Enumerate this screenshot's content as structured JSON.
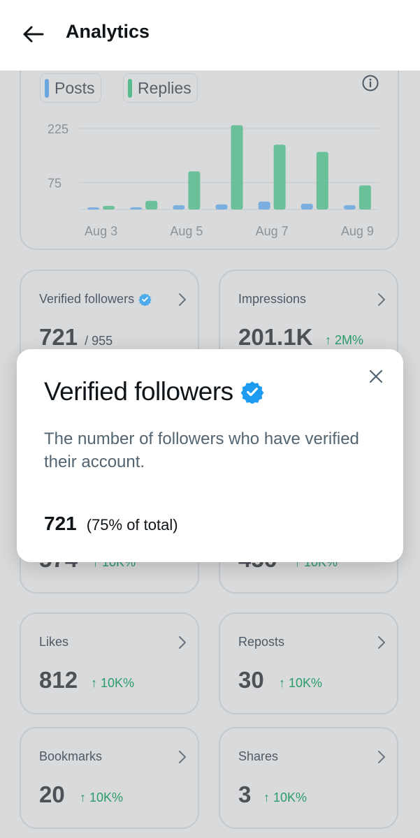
{
  "header": {
    "title": "Analytics"
  },
  "colors": {
    "posts": "#6aa7e0",
    "replies": "#56bb8d",
    "verified_badge": "#1d9bf0",
    "change_positive": "#2a9c69"
  },
  "legend": {
    "posts": "Posts",
    "replies": "Replies"
  },
  "chart_data": {
    "type": "bar",
    "categories": [
      "Aug 3",
      "Aug 4",
      "Aug 5",
      "Aug 6",
      "Aug 7",
      "Aug 8",
      "Aug 9"
    ],
    "x_tick_labels": [
      "Aug 3",
      "Aug 5",
      "Aug 7",
      "Aug 9"
    ],
    "y_tick_labels": [
      "225",
      "75"
    ],
    "ylim": [
      0,
      240
    ],
    "grid": true,
    "legend_position": "top-left",
    "series": [
      {
        "name": "Posts",
        "values": [
          3,
          6,
          12,
          14,
          22,
          16,
          12
        ]
      },
      {
        "name": "Replies",
        "values": [
          10,
          24,
          106,
          234,
          180,
          160,
          67
        ]
      }
    ]
  },
  "stats": [
    {
      "label": "Verified followers",
      "value": "721",
      "sub": "/ 955",
      "verified": true,
      "change": ""
    },
    {
      "label": "Impressions",
      "value": "201.1K",
      "sub": "",
      "verified": false,
      "change": "↑ 2M%"
    },
    {
      "label": "",
      "value": "574",
      "sub": "",
      "verified": false,
      "change": "↑ 10K%"
    },
    {
      "label": "",
      "value": "456",
      "sub": "",
      "verified": false,
      "change": "↑ 10K%"
    },
    {
      "label": "Likes",
      "value": "812",
      "sub": "",
      "verified": false,
      "change": "↑ 10K%"
    },
    {
      "label": "Reposts",
      "value": "30",
      "sub": "",
      "verified": false,
      "change": "↑ 10K%"
    },
    {
      "label": "Bookmarks",
      "value": "20",
      "sub": "",
      "verified": false,
      "change": "↑ 10K%"
    },
    {
      "label": "Shares",
      "value": "3",
      "sub": "",
      "verified": false,
      "change": "↑ 10K%"
    }
  ],
  "dialog": {
    "title": "Verified followers",
    "description": "The number of followers who have verified their account.",
    "value": "721",
    "percent": "(75% of total)"
  }
}
